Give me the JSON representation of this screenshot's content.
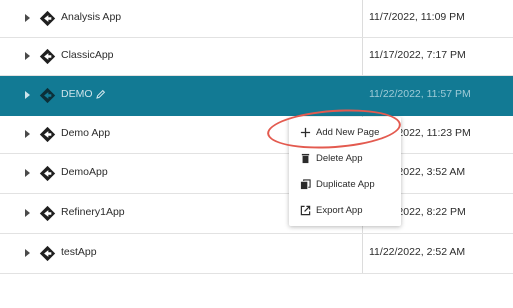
{
  "apps": [
    {
      "name": "Analysis App",
      "modified": "11/7/2022, 11:09 PM",
      "selected": false
    },
    {
      "name": "ClassicApp",
      "modified": "11/17/2022, 7:17 PM",
      "selected": false
    },
    {
      "name": "DEMO",
      "modified": "11/22/2022, 11:57 PM",
      "selected": true
    },
    {
      "name": "Demo App",
      "modified": "11/22/2022, 11:23 PM",
      "selected": false
    },
    {
      "name": "DemoApp",
      "modified": "11/22/2022, 3:52 AM",
      "selected": false
    },
    {
      "name": "Refinery1App",
      "modified": "11/18/2022, 8:22 PM",
      "selected": false
    },
    {
      "name": "testApp",
      "modified": "11/22/2022, 2:52 AM",
      "selected": false
    }
  ],
  "context_menu": {
    "items": [
      {
        "label": "Add New Page",
        "icon": "plus-icon"
      },
      {
        "label": "Delete App",
        "icon": "trash-icon"
      },
      {
        "label": "Duplicate App",
        "icon": "duplicate-icon"
      },
      {
        "label": "Export App",
        "icon": "export-icon"
      }
    ]
  },
  "colors": {
    "selected_row": "#127a94",
    "highlight_ring": "#e35a4f"
  }
}
